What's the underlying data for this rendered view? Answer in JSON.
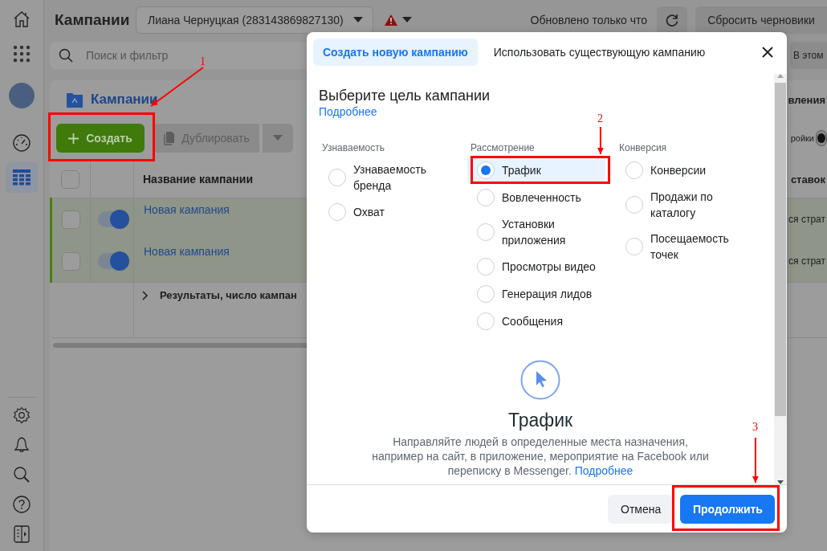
{
  "sidebar": {
    "top": [
      {
        "kind": "home",
        "selected": false
      },
      {
        "kind": "apps",
        "selected": false
      },
      {
        "kind": "avatar",
        "selected": false
      },
      {
        "kind": "gauge",
        "selected": false
      },
      {
        "kind": "table",
        "selected": true
      }
    ],
    "bottom": [
      {
        "kind": "settings",
        "selected": false
      },
      {
        "kind": "bell",
        "selected": false
      },
      {
        "kind": "search",
        "selected": false
      },
      {
        "kind": "help",
        "selected": false
      },
      {
        "kind": "panel",
        "selected": false
      }
    ]
  },
  "header": {
    "title": "Кампании",
    "account": "Лиана Чернуцкая (283143869827130)",
    "status": "Обновлено только что",
    "discard_button": "Сбросить черновики"
  },
  "search": {
    "placeholder": "Поиск и фильтр",
    "scope": "В этом"
  },
  "panel": {
    "title": "Кампании",
    "tab": "вления",
    "create_button": "Создать",
    "duplicate_button": "Дублировать",
    "settings_label": "ройки",
    "settings_on": false
  },
  "table": {
    "select_all_checked": false,
    "columns": [
      "Название кампании",
      "ставок"
    ],
    "rows": [
      {
        "checked": false,
        "on": true,
        "name": "Новая кампания",
        "column_2": "ся страт"
      },
      {
        "checked": false,
        "on": true,
        "name": "Новая кампания",
        "column_2": "ся страт"
      }
    ],
    "summary": "Результаты, число кампан"
  },
  "modal": {
    "tabs": [
      {
        "label": "Создать новую кампанию",
        "selected": true
      },
      {
        "label": "Использовать существующую кампанию",
        "selected": false
      }
    ],
    "heading": "Выберите цель кампании",
    "learn_more": "Подробнее",
    "groups": [
      {
        "label": "Узнаваемость",
        "options": [
          {
            "label": "Узнаваемость бренда",
            "selected": false
          },
          {
            "label": "Охват",
            "selected": false
          }
        ]
      },
      {
        "label": "Рассмотрение",
        "options": [
          {
            "label": "Трафик",
            "selected": true
          },
          {
            "label": "Вовлеченность",
            "selected": false
          },
          {
            "label": "Установки приложения",
            "selected": false
          },
          {
            "label": "Просмотры видео",
            "selected": false
          },
          {
            "label": "Генерация лидов",
            "selected": false
          },
          {
            "label": "Сообщения",
            "selected": false
          }
        ]
      },
      {
        "label": "Конверсия",
        "options": [
          {
            "label": "Конверсии",
            "selected": false
          },
          {
            "label": "Продажи по каталогу",
            "selected": false
          },
          {
            "label": "Посещаемость точек",
            "selected": false
          }
        ]
      }
    ],
    "detail": {
      "title": "Трафик",
      "description": "Направляйте людей в определенные места назначения, например на сайт, в приложение, мероприятие на Facebook или переписку в Messenger.",
      "link": "Подробнее"
    },
    "buttons": [
      {
        "label": "Отмена",
        "kind": "secondary"
      },
      {
        "label": "Продолжить",
        "kind": "primary"
      }
    ]
  },
  "annotations": [
    {
      "number": "1"
    },
    {
      "number": "2"
    },
    {
      "number": "3"
    }
  ]
}
